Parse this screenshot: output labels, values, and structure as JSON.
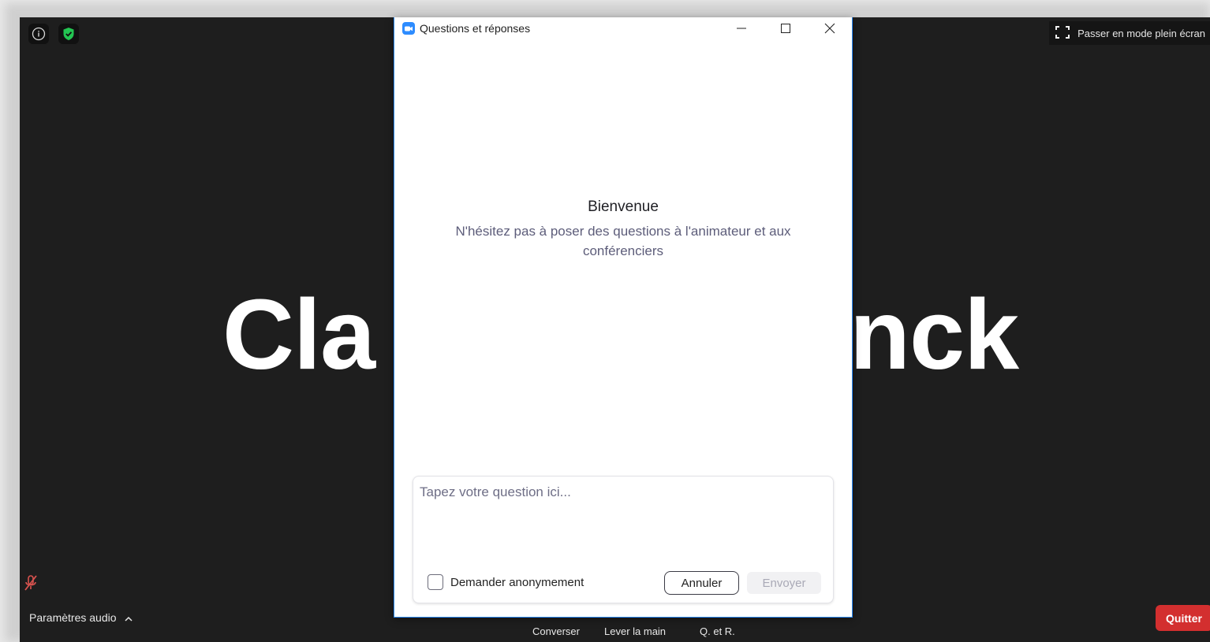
{
  "meeting": {
    "background_color": "#1e1e1e",
    "participant_name_visible_left": "Cla",
    "participant_name_visible_right": "nck",
    "fullscreen_label": "Passer en mode plein écran",
    "audio_settings_label": "Paramètres audio",
    "toolbar": {
      "chat_label": "Converser",
      "raise_hand_label": "Lever la main",
      "qa_label": "Q. et R."
    },
    "quit_label": "Quitter",
    "quit_color": "#d32f2f"
  },
  "dialog": {
    "title": "Questions et réponses",
    "welcome_title": "Bienvenue",
    "welcome_text": "N'hésitez pas à poser des questions à l'animateur et aux conférenciers",
    "input_placeholder": "Tapez votre question ici...",
    "input_value": "",
    "anonymous_label": "Demander anonymement",
    "anonymous_checked": false,
    "cancel_label": "Annuler",
    "send_label": "Envoyer",
    "send_enabled": false
  },
  "icons": [
    "info-icon",
    "security-shield-icon",
    "fullscreen-icon",
    "muted-mic-icon",
    "chevron-up-icon",
    "zoom-app-icon",
    "minimize-icon",
    "maximize-icon",
    "close-icon"
  ]
}
